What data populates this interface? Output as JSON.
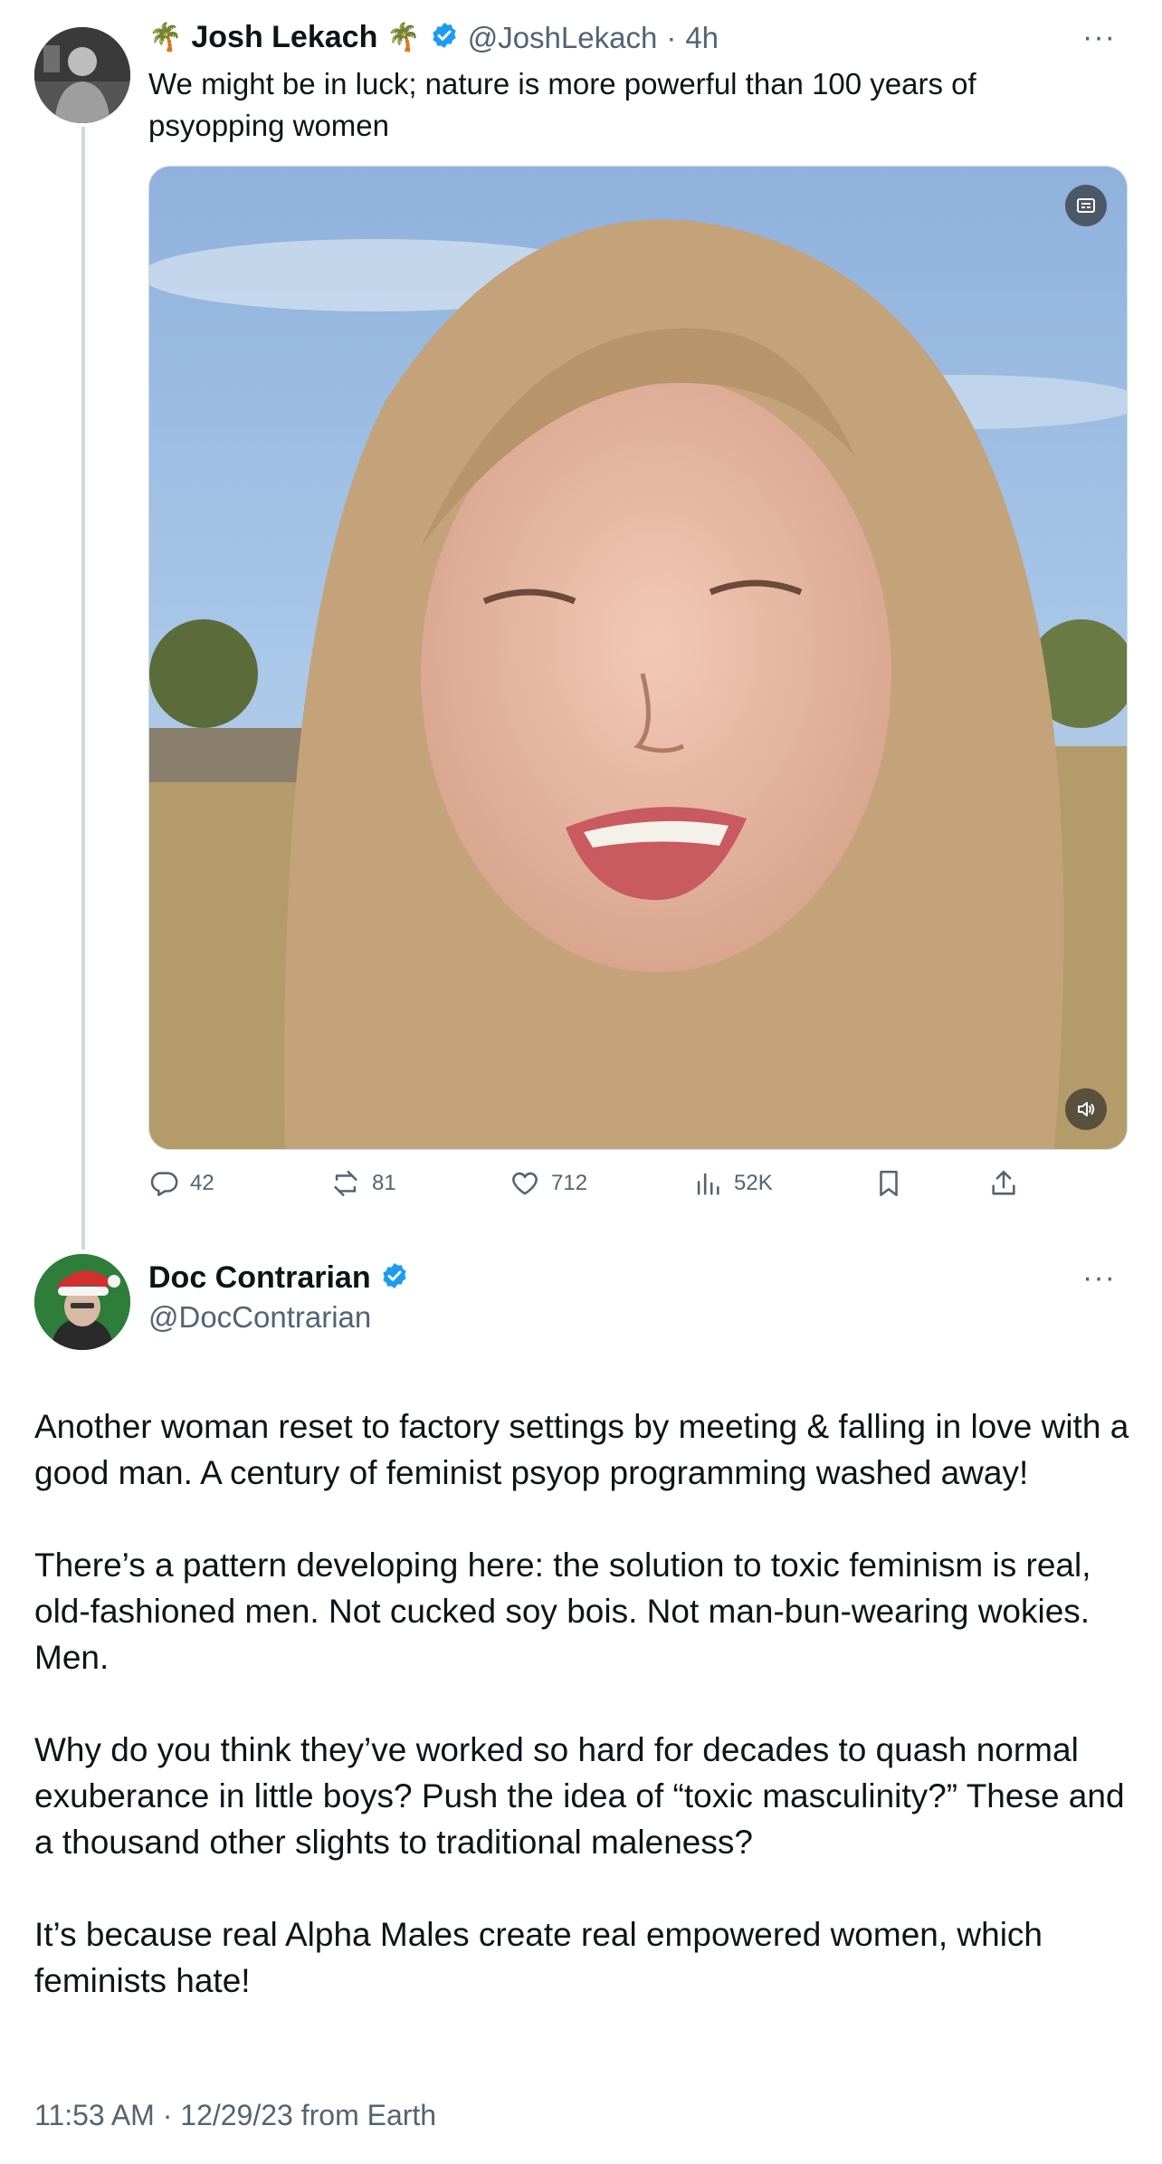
{
  "tweet1": {
    "name": "Josh Lekach",
    "name_emoji": "🌴",
    "handle": "@JoshLekach",
    "separator": "·",
    "time": "4h",
    "more": "···",
    "text_line1": "We might be in luck; nature is more powerful than 100 years of",
    "text_line2": "psyopping women",
    "media": {
      "type": "video"
    },
    "actions": {
      "replies": "42",
      "reposts": "81",
      "likes": "712",
      "views": "52K"
    }
  },
  "tweet2": {
    "name": "Doc Contrarian",
    "handle": "@DocContrarian",
    "more": "···",
    "paragraphs": [
      "Another woman reset to factory settings by meeting & falling in love with a good man. A century of feminist psyop programming washed away!",
      "There’s a pattern developing here: the solution to toxic feminism is real, old-fashioned men. Not cucked soy bois. Not man-bun-wearing wokies. Men.",
      "Why do you think they’ve worked so hard for decades to quash normal exuberance in little boys? Push the idea of “toxic masculinity?” These and a thousand other slights to traditional maleness?",
      "It’s because real Alpha Males create real empowered women, which feminists hate!"
    ],
    "timestamp": "11:53 AM · 12/29/23 from Earth"
  },
  "colors": {
    "verified": "#1d9bf0",
    "secondary_text": "#536471",
    "thread_line": "#cfd9de"
  }
}
